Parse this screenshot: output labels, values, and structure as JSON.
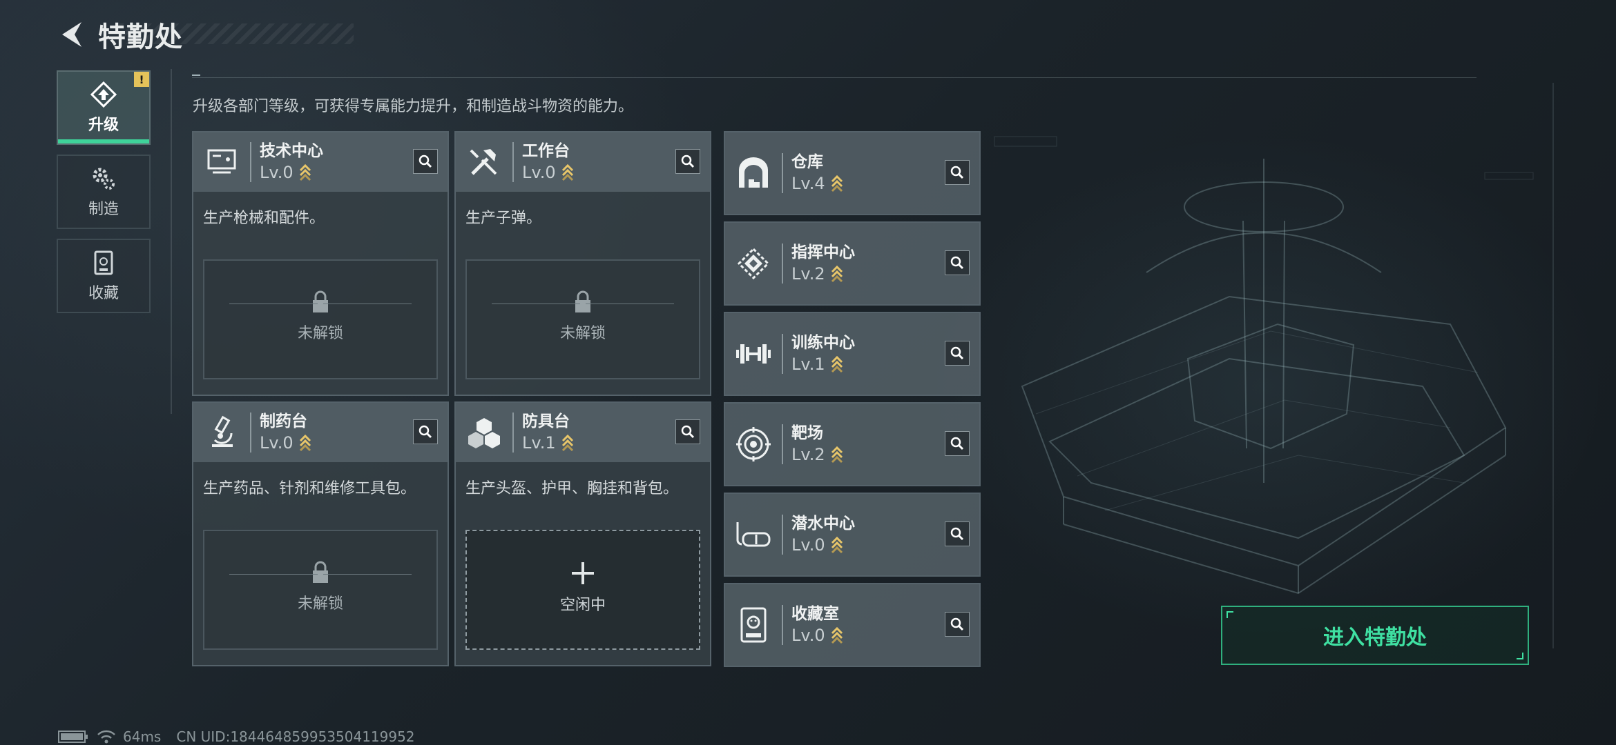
{
  "header": {
    "title": "特勤处",
    "back_icon": "back-arrow-icon"
  },
  "sidebar": {
    "items": [
      {
        "label": "升级",
        "icon": "upgrade-icon",
        "active": true,
        "alert": "!"
      },
      {
        "label": "制造",
        "icon": "gears-icon",
        "active": false
      },
      {
        "label": "收藏",
        "icon": "collection-icon",
        "active": false
      }
    ]
  },
  "description": "升级各部门等级，可获得专属能力提升，和制造战斗物资的能力。",
  "cards": [
    {
      "name": "技术中心",
      "level": "Lv.0",
      "desc": "生产枪械和配件。",
      "status": "未解锁",
      "icon": "tech-monitor-icon"
    },
    {
      "name": "工作台",
      "level": "Lv.0",
      "desc": "生产子弹。",
      "status": "未解锁",
      "icon": "tools-icon"
    },
    {
      "name": "制药台",
      "level": "Lv.0",
      "desc": "生产药品、针剂和维修工具包。",
      "status": "未解锁",
      "icon": "microscope-icon"
    },
    {
      "name": "防具台",
      "level": "Lv.1",
      "desc": "生产头盔、护甲、胸挂和背包。",
      "status": "空闲中",
      "icon": "cubes-icon"
    }
  ],
  "side_cards": [
    {
      "name": "仓库",
      "level": "Lv.4",
      "icon": "warehouse-icon"
    },
    {
      "name": "指挥中心",
      "level": "Lv.2",
      "icon": "chip-icon"
    },
    {
      "name": "训练中心",
      "level": "Lv.1",
      "icon": "dumbbell-icon"
    },
    {
      "name": "靶场",
      "level": "Lv.2",
      "icon": "target-icon"
    },
    {
      "name": "潜水中心",
      "level": "Lv.0",
      "icon": "diving-mask-icon"
    },
    {
      "name": "收藏室",
      "level": "Lv.0",
      "icon": "collection-room-icon"
    }
  ],
  "enter_button": "进入特勤处",
  "status_bar": {
    "ping": "64ms",
    "uid": "CN UID:18446485995350411995​2"
  },
  "colors": {
    "accent": "#3fe0a2",
    "chevron": "#e8c66a",
    "alert": "#e5c35a"
  }
}
